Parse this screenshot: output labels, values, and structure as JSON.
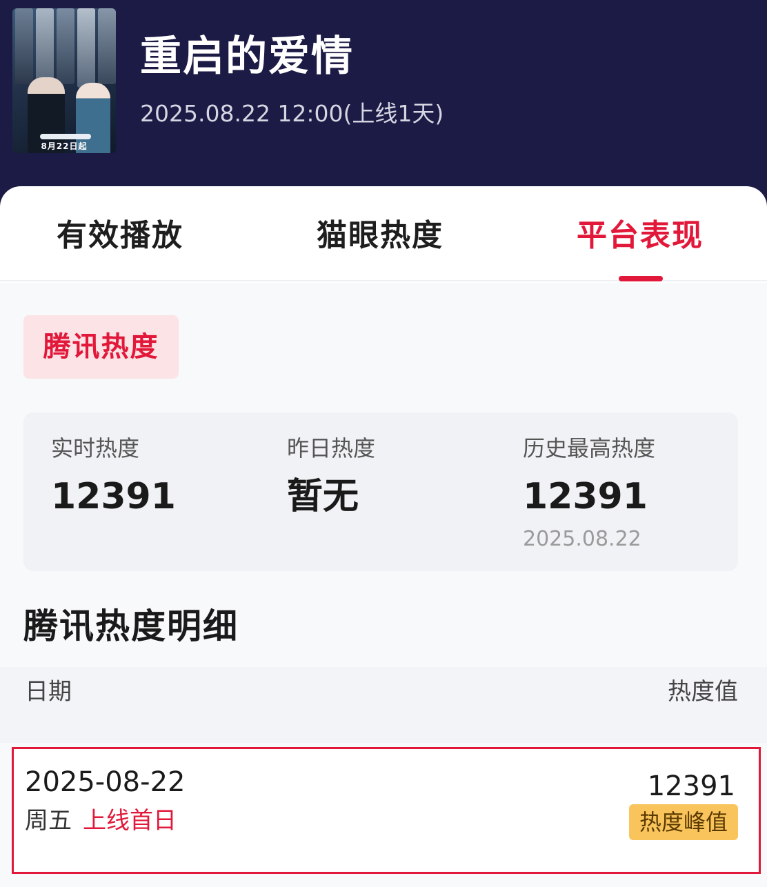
{
  "header": {
    "poster_caption": "8月22日起",
    "title": "重启的爱情",
    "subtitle": "2025.08.22 12:00(上线1天)"
  },
  "tabs": [
    {
      "label": "有效播放",
      "active": false
    },
    {
      "label": "猫眼热度",
      "active": false
    },
    {
      "label": "平台表现",
      "active": true
    }
  ],
  "platform_chip": {
    "label": "腾讯热度"
  },
  "stats": {
    "realtime": {
      "label": "实时热度",
      "value": "12391"
    },
    "yesterday": {
      "label": "昨日热度",
      "value": "暂无"
    },
    "history_max": {
      "label": "历史最高热度",
      "value": "12391",
      "date": "2025.08.22"
    }
  },
  "detail": {
    "title": "腾讯热度明细",
    "columns": {
      "date": "日期",
      "value": "热度值"
    },
    "rows": [
      {
        "date": "2025-08-22",
        "weekday": "周五",
        "tag": "上线首日",
        "value": "12391",
        "badge": "热度峰值"
      }
    ]
  },
  "colors": {
    "header_bg": "#1c1b45",
    "accent": "#e2183a",
    "badge_bg": "#f9c45c"
  }
}
